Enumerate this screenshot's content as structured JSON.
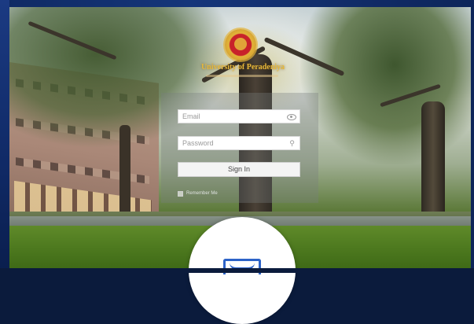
{
  "brand": {
    "university_name": "University of Peradeniya"
  },
  "login": {
    "email_placeholder": "Email",
    "password_placeholder": "Password",
    "signin_label": "Sign In",
    "remember_label": "Remember Me"
  },
  "icons": {
    "email_field_icon": "eye-icon",
    "password_field_icon": "key-icon",
    "bubble_icon": "monitor-icon"
  },
  "colors": {
    "frame": "#0f2a63",
    "logo_gold": "#e2b33a",
    "logo_red": "#c8222a",
    "bubble_icon_blue": "#2d63c8"
  }
}
